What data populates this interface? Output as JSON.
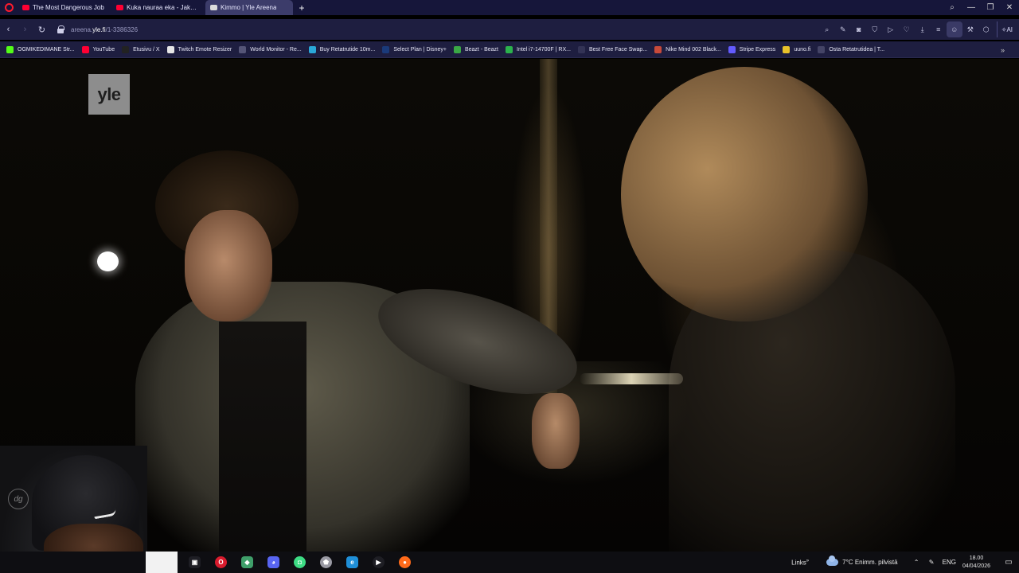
{
  "browser": {
    "tabs": [
      {
        "title": "The Most Dangerous Job",
        "favicon": "youtube-icon",
        "active": false
      },
      {
        "title": "Kuka nauraa eka - Jakso 2",
        "favicon": "youtube-icon",
        "active": false
      },
      {
        "title": "Kimmo | Yle Areena",
        "favicon": "yle-icon",
        "active": true
      }
    ],
    "url_prefix": "areena.",
    "url_domain": "yle.fi",
    "url_path": "/1-3386326",
    "ai_label": "AI"
  },
  "bookmarks": [
    {
      "label": "OGMIKEDIMANE Str...",
      "icon": "kick-icon",
      "color": "#53fc18"
    },
    {
      "label": "YouTube",
      "icon": "youtube-icon",
      "color": "#ff0033"
    },
    {
      "label": "Etusivu / X",
      "icon": "x-icon",
      "color": "#222222"
    },
    {
      "label": "Twitch Emote Resizer",
      "icon": "page-icon",
      "color": "#e6e6e6"
    },
    {
      "label": "World Monitor - Re...",
      "icon": "dash-icon",
      "color": "#555577"
    },
    {
      "label": "Buy Retatrutide 10m...",
      "icon": "globe-icon",
      "color": "#2aa8d8"
    },
    {
      "label": "Select Plan | Disney+",
      "icon": "disney-icon",
      "color": "#1a3a7a"
    },
    {
      "label": "Beazt - Beazt",
      "icon": "beazt-icon",
      "color": "#3aa845"
    },
    {
      "label": "Intel i7-14700F | RX...",
      "icon": "store-icon",
      "color": "#2bb24c"
    },
    {
      "label": "Best Free Face Swap...",
      "icon": "faceswap-icon",
      "color": "#333355"
    },
    {
      "label": "Nike Mind 002 Black...",
      "icon": "nike-icon",
      "color": "#c84a3a"
    },
    {
      "label": "Stripe Express",
      "icon": "stripe-icon",
      "color": "#635bff"
    },
    {
      "label": "uuno.fi",
      "icon": "uuno-icon",
      "color": "#e8c22a"
    },
    {
      "label": "Osta Retatrutidea | T...",
      "icon": "shop-icon",
      "color": "#444466"
    }
  ],
  "video": {
    "overlay_logo": "yle",
    "webcam_watermark": "dg"
  },
  "taskbar": {
    "links_label": "Links",
    "links_badge": "»",
    "temperature": "7°C",
    "weather_text": "Enimm. pilvistä",
    "language": "ENG",
    "time": "18.00",
    "date": "04/04/2026",
    "apps": [
      {
        "name": "task-view-icon",
        "glyph": "▣",
        "color": "#1e1e24"
      },
      {
        "name": "opera-icon",
        "glyph": "O",
        "color": "#d81b2d"
      },
      {
        "name": "colorful-app-icon",
        "glyph": "◆",
        "color": "#3f9f6a"
      },
      {
        "name": "discord-icon",
        "glyph": "◕",
        "color": "#5865f2"
      },
      {
        "name": "android-app-icon",
        "glyph": "◘",
        "color": "#3ddc84"
      },
      {
        "name": "shield-app-icon",
        "glyph": "⬟",
        "color": "#9a9aa4"
      },
      {
        "name": "edge-icon",
        "glyph": "e",
        "color": "#1f8fd8"
      },
      {
        "name": "play-app-icon",
        "glyph": "▶",
        "color": "#1e1e24"
      },
      {
        "name": "firefox-icon",
        "glyph": "●",
        "color": "#ff6a1a"
      }
    ]
  }
}
